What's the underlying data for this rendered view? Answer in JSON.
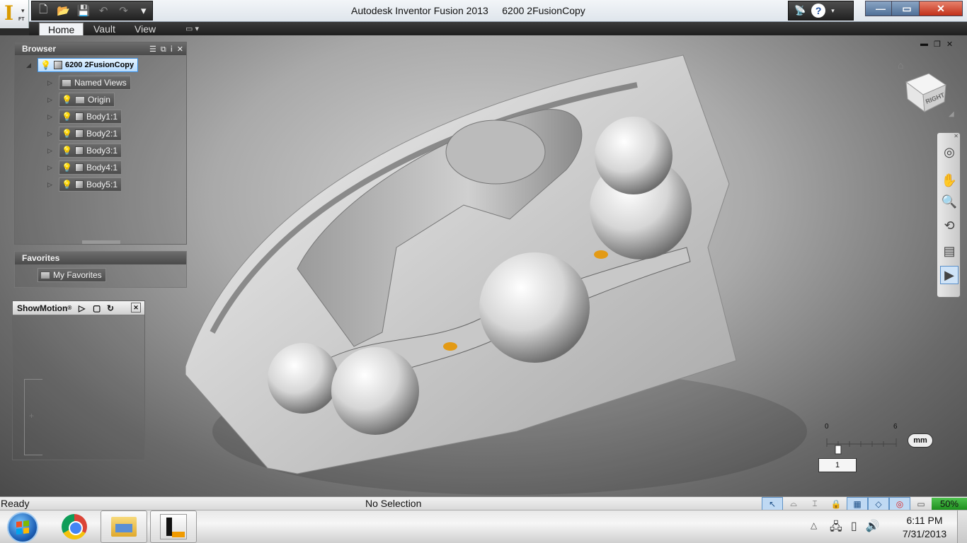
{
  "titlebar": {
    "app_name": "Autodesk Inventor Fusion 2013",
    "document": "6200 2FusionCopy",
    "logo_letter": "I",
    "logo_sub": "FT"
  },
  "ribbon": {
    "tabs": [
      {
        "label": "Home",
        "active": true
      },
      {
        "label": "Vault",
        "active": false
      },
      {
        "label": "View",
        "active": false
      }
    ]
  },
  "browser": {
    "title": "Browser",
    "root": "6200 2FusionCopy",
    "nodes": [
      "Named Views",
      "Origin",
      "Body1:1",
      "Body2:1",
      "Body3:1",
      "Body4:1",
      "Body5:1"
    ]
  },
  "favorites": {
    "title": "Favorites",
    "item": "My Favorites"
  },
  "showmotion": {
    "title": "ShowMotion"
  },
  "viewcube": {
    "face": "RIGHT"
  },
  "ruler": {
    "min": "0",
    "max": "6",
    "unit": "mm",
    "scale": "1"
  },
  "status": {
    "left": "Ready",
    "center": "No Selection",
    "percent": "50%"
  },
  "clock": {
    "time": "6:11 PM",
    "date": "7/31/2013"
  },
  "colors": {
    "accent": "#3d8fe0",
    "highlight": "#f09a00"
  }
}
